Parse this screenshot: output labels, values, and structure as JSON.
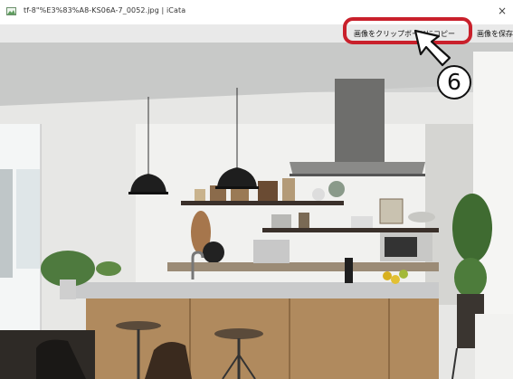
{
  "window": {
    "title": "tf-8\"%E3%83%A8-KS06A-7_0052.jpg | iCata",
    "close_glyph": "×"
  },
  "toolbar": {
    "copy_label": "画像をクリップボードにコピー",
    "save_label": "画像を保存"
  },
  "annotation": {
    "step_number": "6"
  },
  "colors": {
    "highlight": "#c9202b",
    "toolbar_bg": "#e9e9e9"
  },
  "icons": [
    "image-file-icon",
    "close-icon",
    "cursor-arrow-icon"
  ]
}
